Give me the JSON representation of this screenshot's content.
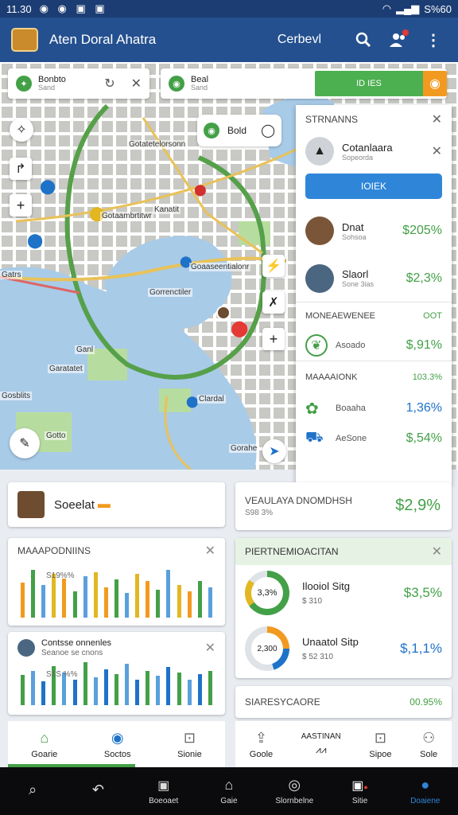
{
  "status_bar": {
    "time": "11.30",
    "right_text": "S%60"
  },
  "app": {
    "title": "Aten Doral Ahatra",
    "account": "Cerbevl"
  },
  "search_left": {
    "title": "Bonbto",
    "sub": "Sand"
  },
  "search_right": {
    "title": "Beal",
    "sub": "Sand"
  },
  "route_button": {
    "label": "ID IES"
  },
  "map": {
    "labels": [
      "Gotatetelorsonn",
      "Kanatit",
      "Gotaambrtitwr",
      "Goaaseentialonr",
      "Gorrenctiler",
      "Garatatet",
      "Gatrs",
      "Ganl",
      "Clardal",
      "Gorahe",
      "Gosblits",
      "Gotto"
    ],
    "popup": "Bold"
  },
  "side_panel": {
    "header": "STRNANNS",
    "user": {
      "name": "Cotanlaara",
      "sub": "Sopeorda"
    },
    "button": "IOIEK",
    "people": [
      {
        "name": "Dnat",
        "sub": "Sohsoa",
        "value": "$205%",
        "color": "#43a047"
      },
      {
        "name": "Slaorl",
        "sub": "Sone 3ias",
        "value": "$2,3%",
        "color": "#43a047"
      }
    ],
    "section1": {
      "title": "MONEAEWENEE",
      "tag": "OOT",
      "item": {
        "label": "Asoado",
        "value": "$,91%",
        "color": "#43a047"
      }
    },
    "section2": {
      "title": "MAAAAIONK",
      "tag": "103.3%",
      "items": [
        {
          "label": "Boaaha",
          "value": "1,36%",
          "color": "#1e72c8"
        },
        {
          "label": "AeSone",
          "value": "$,54%",
          "color": "#43a047"
        }
      ]
    }
  },
  "card_social": {
    "label": "Soeelat"
  },
  "card_value": {
    "title": "VEAULAYA DNOMDHSH",
    "sub": "S98 3%",
    "value": "$2,9%"
  },
  "card_chart1": {
    "title": "MAAAPODNIINS",
    "sub": "S19%%"
  },
  "card_chart2": {
    "title": "Contsse onnenles",
    "sub": "Seanoe se cnons",
    "inner": "S1S %%"
  },
  "card_pie": {
    "title": "PIERTNEMIOACITAN",
    "rows": [
      {
        "ring": "3,3%",
        "title": "Ilooiol Sitg",
        "sub": "$ 310",
        "value": "$3,5%",
        "color": "#43a047"
      },
      {
        "ring": "2,300",
        "title": "Unaatol Sitp",
        "sub": "$ 52 310",
        "value": "$,1,1%",
        "color": "#1e72c8"
      }
    ]
  },
  "card_bottom_right": {
    "title": "SIARESYCAORE",
    "value": "00.95%"
  },
  "tabs": [
    {
      "label": "Goarie"
    },
    {
      "label": "Soctos"
    },
    {
      "label": "Sionie"
    },
    {
      "label": "Goole"
    },
    {
      "label": "AASTINAN"
    },
    {
      "label": "Sipoe"
    },
    {
      "label": "Sole"
    }
  ],
  "nav": [
    {
      "label": ""
    },
    {
      "label": ""
    },
    {
      "label": "Boeoaet"
    },
    {
      "label": "Gaie"
    },
    {
      "label": "Slornbelne"
    },
    {
      "label": "Sitie"
    },
    {
      "label": "Doaiene"
    }
  ],
  "chart_data": [
    {
      "type": "bar",
      "series": [
        {
          "name": "",
          "values": [
            40,
            55,
            38,
            50,
            45,
            30,
            48,
            52,
            35,
            44,
            28,
            50,
            42,
            32,
            55,
            38,
            30,
            42,
            35
          ]
        }
      ]
    },
    {
      "type": "bar",
      "series": [
        {
          "name": "",
          "values": [
            35,
            40,
            28,
            45,
            38,
            30,
            50,
            32,
            42,
            36,
            48,
            30,
            40,
            34,
            44,
            38,
            30,
            36,
            40
          ]
        }
      ]
    }
  ]
}
